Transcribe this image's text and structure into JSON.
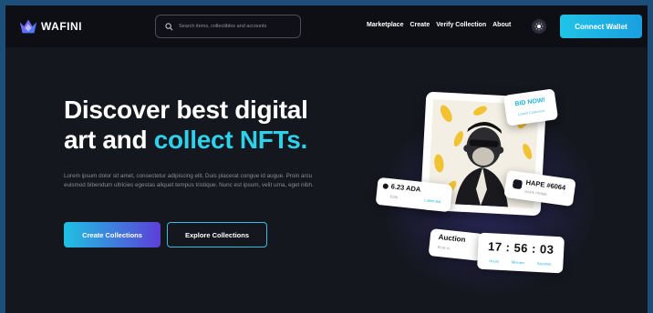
{
  "brand": {
    "name": "WAFINI"
  },
  "search": {
    "placeholder": "Search items, collectibles and accounts"
  },
  "nav": {
    "links": [
      "Marketplace",
      "Create",
      "Verify Collection",
      "About"
    ],
    "connect_label": "Connect Wallet"
  },
  "hero": {
    "title_line1": "Discover best digital",
    "title_line2_prefix": "art and ",
    "title_line2_accent": "collect NFTs.",
    "description": "Lorem ipsum dolor sit amet, consectetur adipiscing elit. Duis placerat congue id augue. Proin arcu euismod bibendum ultricies egestas aliquet tempus tristique. Nunc est ipsum, velit urna, eget nibh.",
    "primary_cta": "Create Collections",
    "secondary_cta": "Explore Collections"
  },
  "nft": {
    "bid_label": "BID NOW!",
    "bid_sub": "Latest Collection",
    "price": "6.23 ADA",
    "price_usd": "$10k",
    "latest_bid": "Latest Bid",
    "name": "HAPE #6064",
    "creator": "HAPE PRIME",
    "auction_label": "Auction",
    "auction_sub": "Ends in",
    "timer": "17 : 56 : 03",
    "timer_units": [
      "Hours",
      "Minutes",
      "Seconds"
    ]
  },
  "colors": {
    "accent": "#2ed0ea",
    "background": "#15171f",
    "navbar": "#0e0f15",
    "outer_border": "#1b4e78"
  }
}
